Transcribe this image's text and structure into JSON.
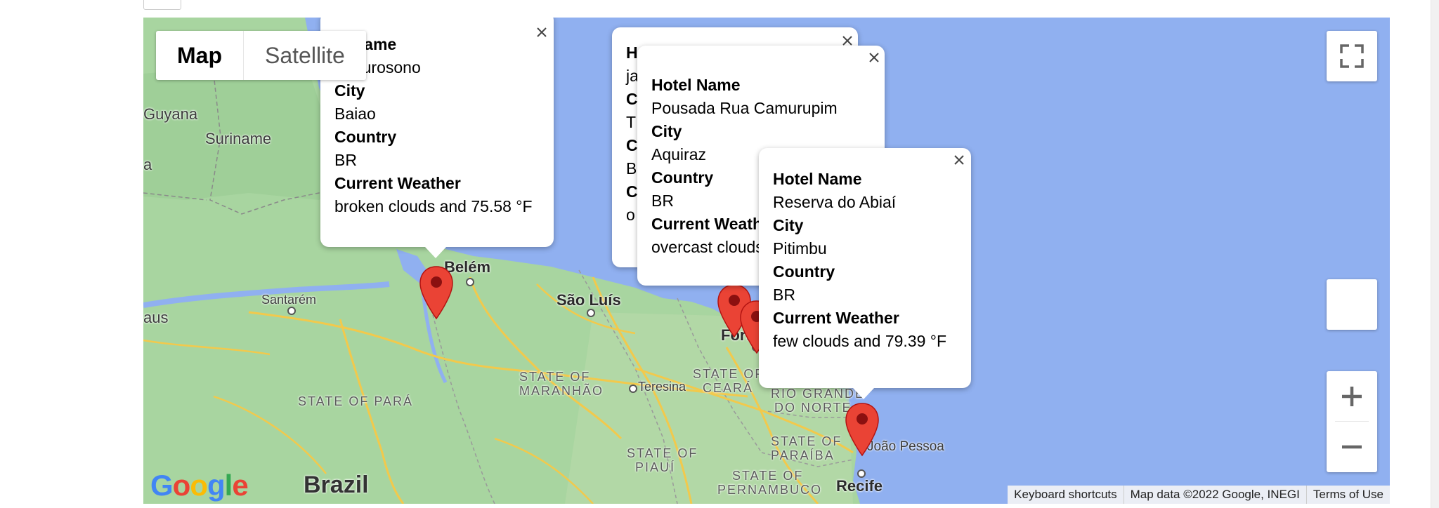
{
  "map_type": {
    "map_label": "Map",
    "satellite_label": "Satellite"
  },
  "places": {
    "guyana": "Guyana",
    "suriname": "Suriname",
    "aus": "aus",
    "a": "a",
    "belem": "Belém",
    "santarem": "Santarém",
    "sao_luis": "São Luís",
    "teresina": "Teresina",
    "fortaleza": "Fort",
    "joao_pessoa": "João Pessoa",
    "recife": "Recife",
    "brazil": "Brazil",
    "state_para": "STATE OF PARÁ",
    "state_maranhao_1": "STATE OF",
    "state_maranhao_2": "MARANHÃO",
    "state_ceara_1": "STATE OF",
    "state_ceara_2": "CEARÁ",
    "state_rgn_1": "RIO GRANDE",
    "state_rgn_2": "DO NORTE",
    "state_paraiba_1": "STATE OF",
    "state_paraiba_2": "PARAÍBA",
    "state_piaui_1": "STATE OF",
    "state_piaui_2": "PIAUÍ",
    "state_pernambuco_1": "STATE OF",
    "state_pernambuco_2": "PERNAMBUCO"
  },
  "infowindows": [
    {
      "hotel_label": "el Name",
      "hotel": "el Eurosono",
      "city_label": "City",
      "city": "Baiao",
      "country_label": "Country",
      "country": "BR",
      "weather_label": "Current Weather",
      "weather": "broken clouds and 75.58 °F"
    },
    {
      "l1": "H",
      "l2": "ja",
      "l3": "C",
      "l4": "T",
      "l5": "C",
      "l6": "B",
      "l7": "C",
      "l8": "o"
    },
    {
      "hotel_label": "Hotel Name",
      "hotel": "Pousada Rua Camurupim",
      "city_label": "City",
      "city": "Aquiraz",
      "country_label": "Country",
      "country": "BR",
      "weather_label": "Current Weath",
      "weather": "overcast clouds"
    },
    {
      "hotel_label": "Hotel Name",
      "hotel": "Reserva do Abiaí",
      "city_label": "City",
      "city": "Pitimbu",
      "country_label": "Country",
      "country": "BR",
      "weather_label": "Current Weather",
      "weather": "few clouds and 79.39 °F"
    }
  ],
  "attribution": {
    "shortcuts": "Keyboard shortcuts",
    "map_data": "Map data ©2022 Google, INEGI",
    "terms": "Terms of Use"
  },
  "logo": "Google",
  "colors": {
    "water": "#90b0f0",
    "land": "#a7d29d",
    "pin": "#ea4335",
    "road": "#f2c94c"
  }
}
